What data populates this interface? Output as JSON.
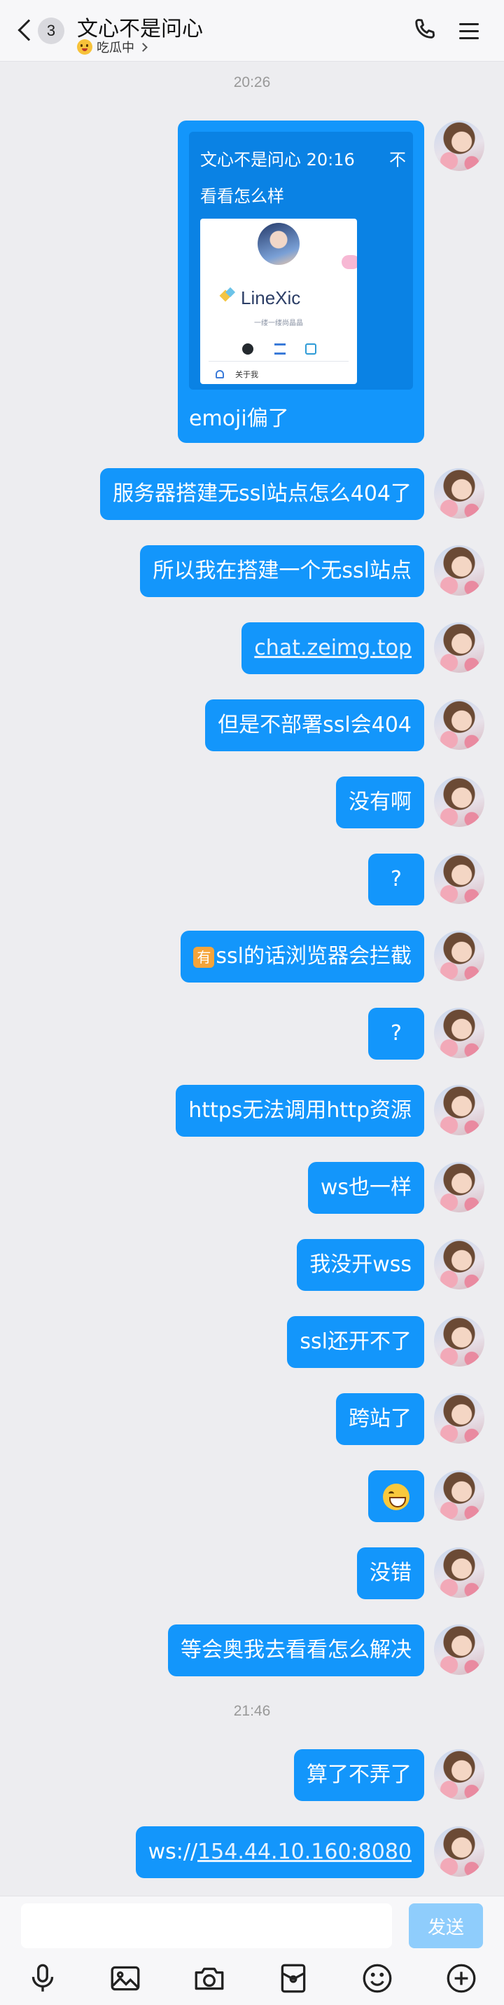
{
  "header": {
    "unread_count": "3",
    "title": "文心不是问心",
    "status": "吃瓜中"
  },
  "timestamps": [
    "20:26",
    "21:46"
  ],
  "forward_card": {
    "meta": "文心不是问心 20:16",
    "close": "不",
    "quote": "看看怎么样",
    "preview_title": "LineXic",
    "preview_subtitle": "一缕一缕尚晶晶",
    "preview_about": "关于我",
    "caption": "emoji偏了"
  },
  "messages": [
    {
      "text": "服务器搭建无ssl站点怎么404了"
    },
    {
      "text": "所以我在搭建一个无ssl站点"
    },
    {
      "text": "chat.zeimg.top",
      "link": true
    },
    {
      "text": "但是不部署ssl会404"
    },
    {
      "text": "没有啊"
    },
    {
      "text": "?"
    },
    {
      "prefix_emoji": "有",
      "text": "ssl的话浏览器会拦截"
    },
    {
      "text": "?"
    },
    {
      "text": "https无法调用http资源"
    },
    {
      "text": "ws也一样"
    },
    {
      "text": "我没开wss"
    },
    {
      "text": "ssl还开不了"
    },
    {
      "text": "跨站了"
    },
    {
      "emoji": "laughing-face"
    },
    {
      "text": "没错"
    },
    {
      "text": "等会奥我去看看怎么解决"
    },
    {
      "text": "算了不弄了"
    },
    {
      "prefix": "ws://",
      "link_text": "154.44.10.160:8080"
    }
  ],
  "composer": {
    "input_value": "",
    "input_placeholder": "",
    "send_label": "发送"
  },
  "toolbar_icons": [
    "microphone-icon",
    "image-icon",
    "camera-icon",
    "red-packet-icon",
    "emoji-icon",
    "plus-icon"
  ],
  "colors": {
    "bubble": "#1396fb",
    "background": "#ededf0",
    "send_disabled": "#8fcdfc"
  }
}
